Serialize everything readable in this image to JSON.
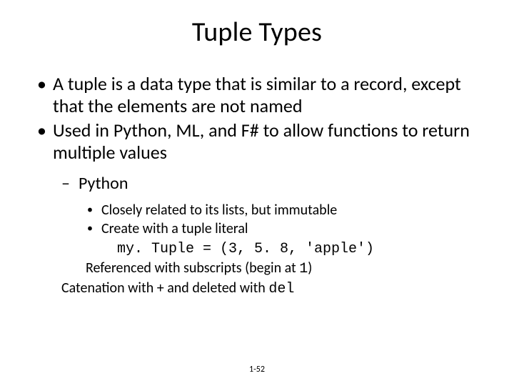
{
  "title": "Tuple Types",
  "bullets": {
    "b1": "A tuple is a data type that is similar to a record, except that the elements are not named",
    "b2": "Used in Python, ML, and F# to allow functions to return multiple values",
    "sub1": "Python",
    "s1": "Closely related to its lists, but immutable",
    "s2": "Create with a tuple literal",
    "code": "my. Tuple = (3, 5. 8, 'apple')",
    "ref_prefix": "Referenced with subscripts (begin at ",
    "ref_code": "1",
    "ref_suffix": ")",
    "cat_prefix": "Catenation with + and deleted with ",
    "cat_code": "del"
  },
  "footer": "1-52"
}
